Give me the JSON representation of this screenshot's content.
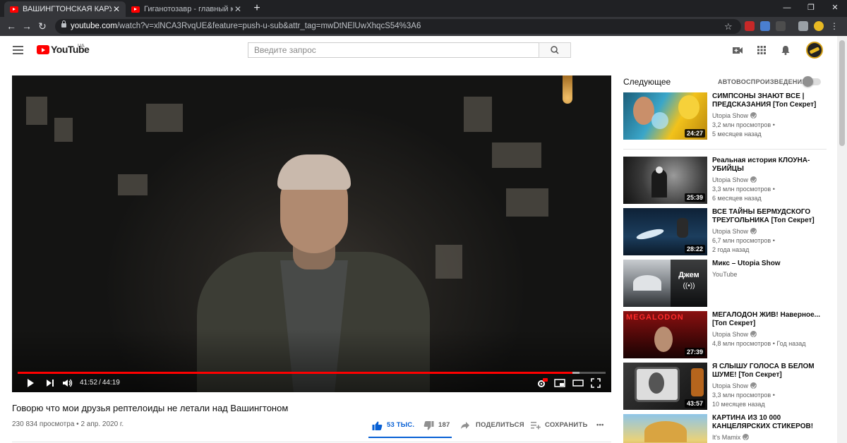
{
  "browser": {
    "tabs": [
      {
        "title": "ВАШИНГТОНСКАЯ КАРУСЕЛЬ / ",
        "active": true
      },
      {
        "title": "Гиганотозавр - главный конкур",
        "active": false
      }
    ],
    "new_tab_label": "+",
    "window_controls": {
      "minimize": "—",
      "restore": "❐",
      "close": "✕"
    },
    "nav": {
      "back": "←",
      "forward": "→",
      "reload": "↻"
    },
    "url_host": "youtube.com",
    "url_rest": "/watch?v=xlNCA3RvqUE&feature=push-u-sub&attr_tag=mwDtNElUwXhqcS54%3A6",
    "star": "☆"
  },
  "header": {
    "logo_text": "YouTube",
    "logo_region": "UA",
    "search_placeholder": "Введите запрос"
  },
  "player": {
    "current_time": "41:52",
    "separator": "/",
    "duration": "44:19",
    "progress": 0.944,
    "buffered": 0.955,
    "hd_badge": "HD"
  },
  "video": {
    "title": "Говорю что мои друзья рептелоиды не летали над Вашингтоном",
    "views": "230 834 просмотра",
    "date": "2 апр. 2020 г.",
    "meta_separator": "•",
    "likes": "53 ТЫС.",
    "dislikes": "187",
    "share": "ПОДЕЛИТЬСЯ",
    "save": "СОХРАНИТЬ",
    "more": "•••",
    "like_ratio": 0.997
  },
  "sidebar": {
    "up_next": "Следующее",
    "autoplay_label": "АВТОВОСПРОИЗВЕДЕНИЕ",
    "autoplay_on": false,
    "items": [
      {
        "title": "СИМПСОНЫ ЗНАЮТ ВСЕ | ПРЕДСКАЗАНИЯ [Топ Секрет]",
        "channel": "Utopia Show",
        "verified": true,
        "views": "3,2 млн просмотров •",
        "age": "5 месяцев назад",
        "duration": "24:27"
      },
      {
        "title": "Реальная история КЛОУНА-УБИЙЦЫ",
        "channel": "Utopia Show",
        "verified": true,
        "views": "3,3 млн просмотров •",
        "age": "6 месяцев назад",
        "duration": "25:39"
      },
      {
        "title": "ВСЕ ТАЙНЫ БЕРМУДСКОГО ТРЕУГОЛЬНИКА [Топ Секрет]",
        "channel": "Utopia Show",
        "verified": true,
        "views": "6,7 млн просмотров •",
        "age": "2 года назад",
        "duration": "28:22"
      },
      {
        "title": "Микс – Utopia Show",
        "channel": "YouTube",
        "verified": false,
        "views": "",
        "age": "",
        "duration": "",
        "mix_label": "Джем",
        "mix_icon": "((•))"
      },
      {
        "title": "МЕГАЛОДОН ЖИВ! Наверное...[Топ Секрет]",
        "channel": "Utopia Show",
        "verified": true,
        "views": "4,8 млн просмотров • Год назад",
        "age": "",
        "duration": "27:39",
        "thumb_text": "MEGALODON"
      },
      {
        "title": "Я СЛЫШУ ГОЛОСА В БЕЛОМ ШУМЕ! [Топ Секрет]",
        "channel": "Utopia Show",
        "verified": true,
        "views": "3,3 млн просмотров •",
        "age": "10 месяцев назад",
        "duration": "43:57"
      },
      {
        "title": "КАРТИНА ИЗ 10 000 КАНЦЕЛЯРСКИХ СТИКЕРОВ!",
        "channel": "It's Mamix",
        "verified": true,
        "views": "",
        "age": "",
        "duration": ""
      }
    ]
  },
  "colors": {
    "accent_red": "#ff0000",
    "like_blue": "#065fd4",
    "chrome_dark": "#202124",
    "chrome_mid": "#35363a"
  }
}
